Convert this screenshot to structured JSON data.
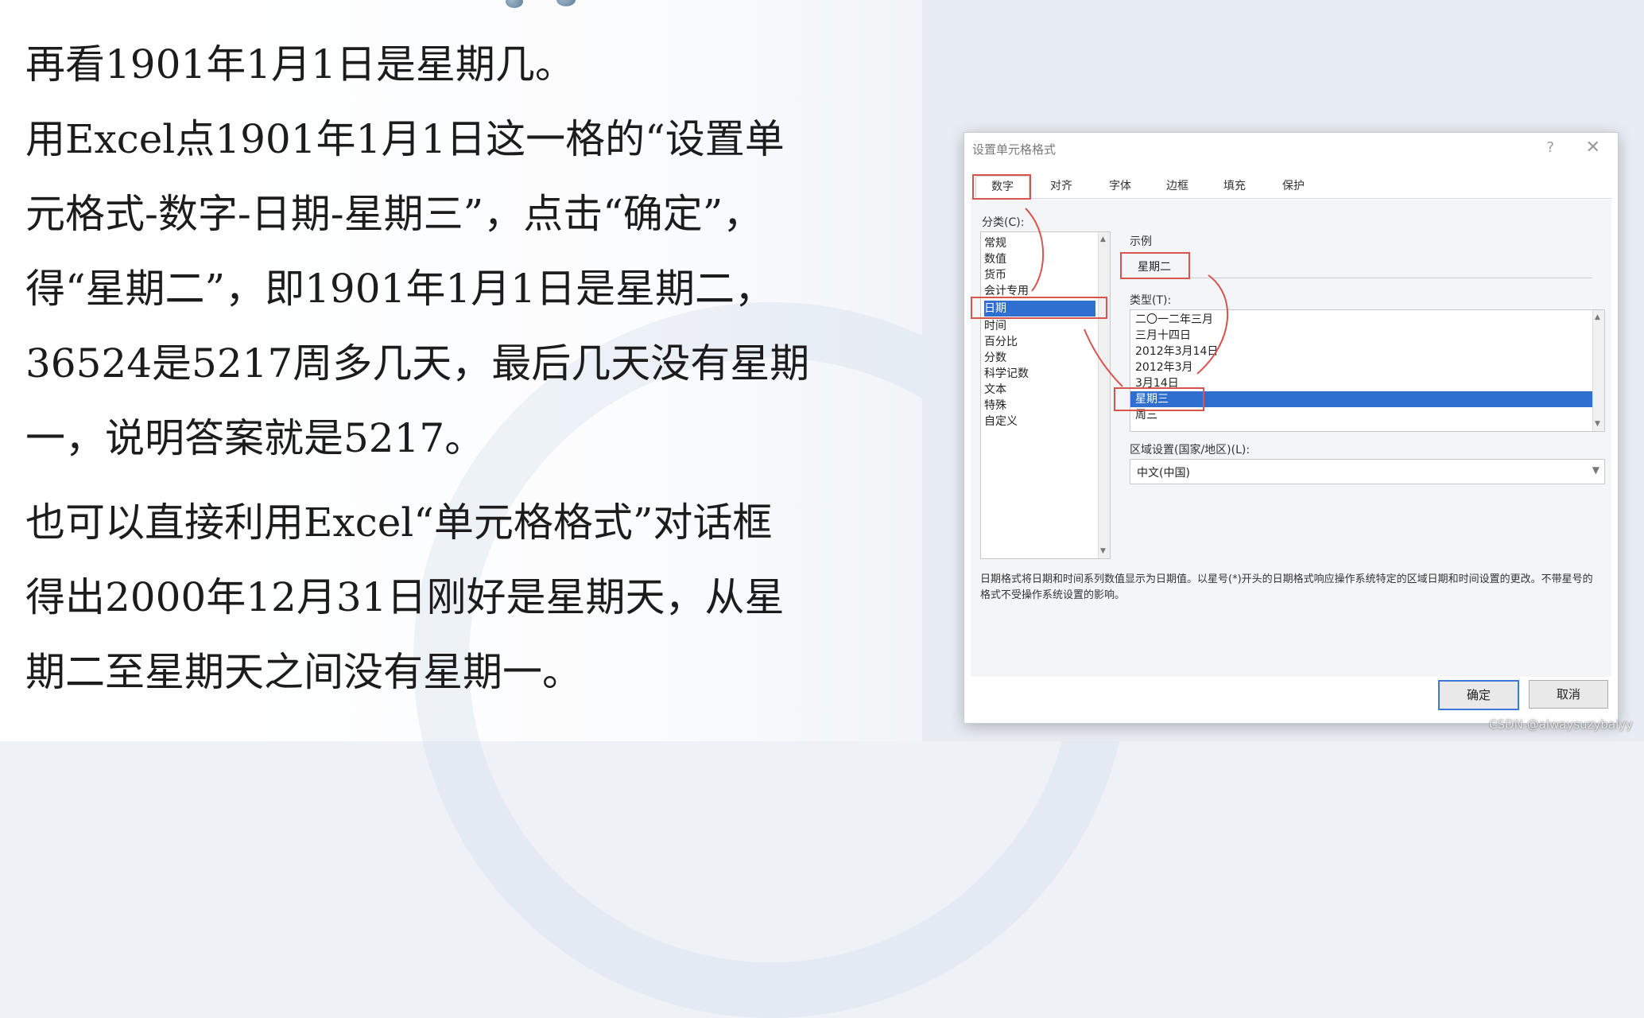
{
  "slide": {
    "lines": [
      "再看1901年1月1日是星期几。",
      "用Excel点1901年1月1日这一格的“设置单",
      "元格式-数字-日期-星期三”，点击“确定”，",
      "得“星期二”，即1901年1月1日是星期二，",
      "36524是5217周多几天，最后几天没有星期",
      "一，说明答案就是5217。",
      "也可以直接利用Excel“单元格格式”对话框",
      "得出2000年12月31日刚好是星期天，从星",
      "期二至星期天之间没有星期一。"
    ]
  },
  "dialog": {
    "title": "设置单元格格式",
    "help": "?",
    "close": "✕",
    "tabs": [
      "数字",
      "对齐",
      "字体",
      "边框",
      "填充",
      "保护"
    ],
    "category_label": "分类(C):",
    "categories": [
      "常规",
      "数值",
      "货币",
      "会计专用",
      "日期",
      "时间",
      "百分比",
      "分数",
      "科学记数",
      "文本",
      "特殊",
      "自定义"
    ],
    "selected_category": "日期",
    "sample_label": "示例",
    "sample_value": "星期二",
    "type_label": "类型(T):",
    "types": [
      "二〇一二年三月",
      "三月十四日",
      "2012年3月14日",
      "2012年3月",
      "3月14日",
      "星期三",
      "周三"
    ],
    "selected_type": "星期三",
    "locale_label": "区域设置(国家/地区)(L):",
    "locale_value": "中文(中国)",
    "description": "日期格式将日期和时间系列数值显示为日期值。以星号(*)开头的日期格式响应操作系统特定的区域日期和时间设置的更改。不带星号的格式不受操作系统设置的影响。",
    "ok": "确定",
    "cancel": "取消"
  },
  "watermark": "CSDN @alwaysuzybaiyy",
  "colors": {
    "highlight": "#2f6fcf",
    "annotation_red": "#d9534f"
  }
}
